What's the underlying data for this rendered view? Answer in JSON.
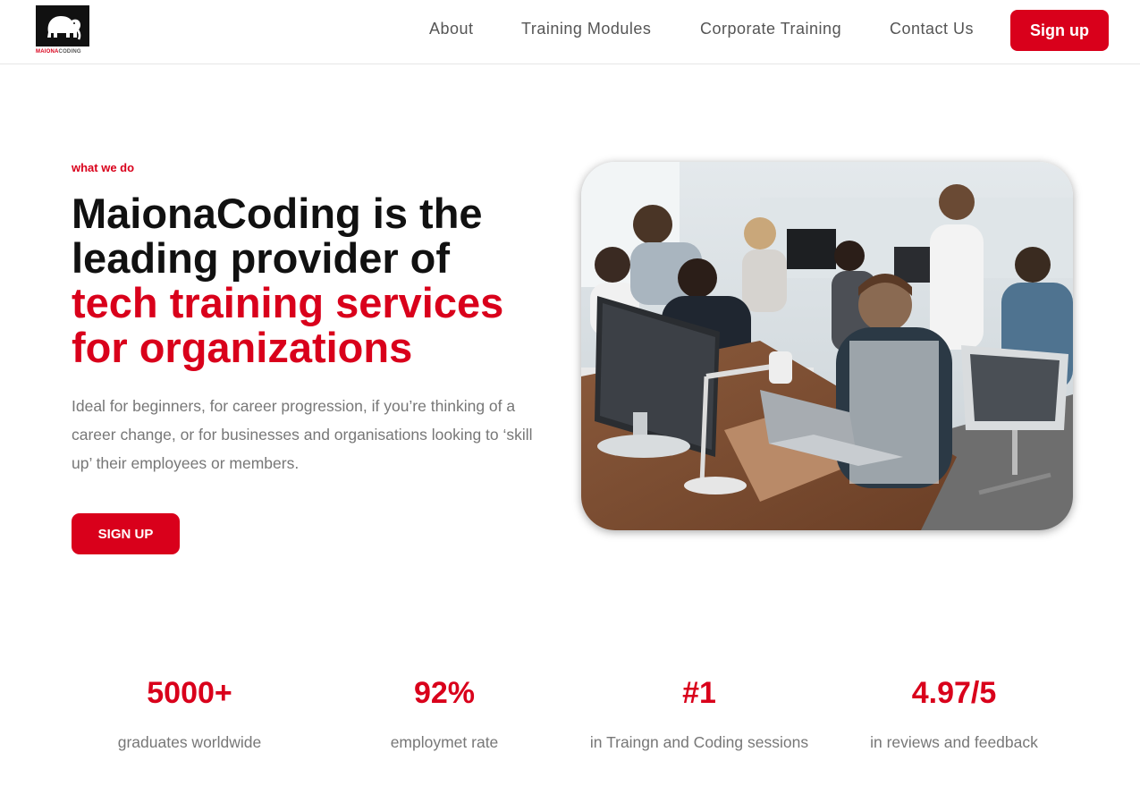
{
  "brand": {
    "logo_text_red": "MAIONA",
    "logo_text_dark": "CODING"
  },
  "nav": {
    "items": [
      {
        "label": "About"
      },
      {
        "label": "Training Modules"
      },
      {
        "label": "Corporate Training"
      },
      {
        "label": "Contact Us"
      }
    ],
    "signup_label": "Sign up"
  },
  "hero": {
    "eyebrow": "what we do",
    "title_line1": "MaionaCoding is the",
    "title_line2": "leading provider of",
    "title_accent_line1": "tech training services",
    "title_accent_line2": "for organizations",
    "description": "Ideal for beginners, for career progression, if you’re thinking of a career change, or for businesses and organisations looking to ‘skill up’ their employees or members.",
    "cta_label": "SIGN UP",
    "image_icon": "office-photo-icon"
  },
  "stats": [
    {
      "value": "5000+",
      "label": "graduates worldwide"
    },
    {
      "value": "92%",
      "label": "employmet rate"
    },
    {
      "value": "#1",
      "label": "in Traingn and Coding sessions"
    },
    {
      "value": "4.97/5",
      "label": "in reviews and feedback"
    }
  ],
  "colors": {
    "accent": "#d9001b",
    "text_dark": "#111111",
    "text_muted": "#777777",
    "nav_text": "#555555"
  }
}
